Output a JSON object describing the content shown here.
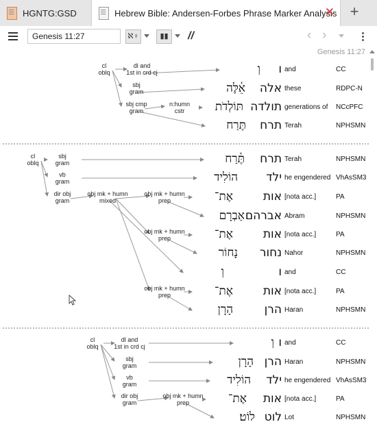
{
  "tabs": [
    {
      "label": "HGNTG:GSD"
    },
    {
      "label": "Hebrew Bible: Andersen-Forbes Phrase Marker Analysis"
    }
  ],
  "toolbar": {
    "reference": "Genesis 11:27",
    "view_button": "ℵ♀",
    "layout_button": "▮▮",
    "format_label": "//"
  },
  "verse_ref": "Genesis 11:27",
  "blocks": [
    {
      "nodes": [
        {
          "t": "cl\noblq"
        },
        {
          "t": "dl and\n1st in crd cj"
        },
        {
          "t": "sbj\ngram"
        },
        {
          "t": "sbj cmp\ngram"
        },
        {
          "t": "n:humn\ncstr"
        }
      ],
      "rows": [
        {
          "heb": "וְ",
          "cons": "ו",
          "gloss": "and",
          "morph": "CC"
        },
        {
          "heb": "אֵ֫לֶּה",
          "cons": "אלה",
          "gloss": "these",
          "morph": "RDPC-N"
        },
        {
          "heb": "תּוֹלְדֹת",
          "cons": "תולדה",
          "gloss": "generations of",
          "morph": "NCcPFC"
        },
        {
          "heb": "תֶּרַח",
          "cons": "תרח",
          "gloss": "Terah",
          "morph": "NPHSMN"
        }
      ]
    },
    {
      "nodes": [
        {
          "t": "cl\noblq"
        },
        {
          "t": "sbj\ngram"
        },
        {
          "t": "vb\ngram"
        },
        {
          "t": "dir obj\ngram"
        },
        {
          "t": "obj mk + humn\nmixed"
        },
        {
          "t": "obj mk + humn\nprep"
        },
        {
          "t": "obj mk + humn\nprep"
        },
        {
          "t": "obj mk + humn\nprep"
        }
      ],
      "rows": [
        {
          "heb": "תֶּ֫רַח",
          "cons": "תרח",
          "gloss": "Terah",
          "morph": "NPHSMN"
        },
        {
          "heb": "הוֹלִיד",
          "cons": "ילד",
          "gloss": "he engendered",
          "morph": "VhAsSM3"
        },
        {
          "heb": "אֶת־",
          "cons": "אות",
          "gloss": "[nota acc.]",
          "morph": "PA"
        },
        {
          "heb": "אַבְרָם",
          "cons": "אברהם",
          "gloss": "Abram",
          "morph": "NPHSMN"
        },
        {
          "heb": "אֶת־",
          "cons": "אות",
          "gloss": "[nota acc.]",
          "morph": "PA"
        },
        {
          "heb": "נָחוֹר",
          "cons": "נחור",
          "gloss": "Nahor",
          "morph": "NPHSMN"
        },
        {
          "heb": "וְ",
          "cons": "ו",
          "gloss": "and",
          "morph": "CC"
        },
        {
          "heb": "אֶת־",
          "cons": "אות",
          "gloss": "[nota acc.]",
          "morph": "PA"
        },
        {
          "heb": "הָרָן",
          "cons": "הרן",
          "gloss": "Haran",
          "morph": "NPHSMN"
        }
      ]
    },
    {
      "nodes": [
        {
          "t": "cl\noblq"
        },
        {
          "t": "dl and\n1st in crd cj"
        },
        {
          "t": "sbj\ngram"
        },
        {
          "t": "vb\ngram"
        },
        {
          "t": "dir obj\ngram"
        },
        {
          "t": "obj mk + humn\nprep"
        }
      ],
      "rows": [
        {
          "heb": "וְ",
          "cons": "ו",
          "gloss": "and",
          "morph": "CC"
        },
        {
          "heb": "הָרָן",
          "cons": "הרן",
          "gloss": "Haran",
          "morph": "NPHSMN"
        },
        {
          "heb": "הוֹלִיד",
          "cons": "ילד",
          "gloss": "he engendered",
          "morph": "VhAsSM3"
        },
        {
          "heb": "אֶת־",
          "cons": "אות",
          "gloss": "[nota acc.]",
          "morph": "PA"
        },
        {
          "heb": "לוֹט׃",
          "cons": "לוט",
          "gloss": "Lot",
          "morph": "NPHSMN"
        }
      ]
    }
  ]
}
